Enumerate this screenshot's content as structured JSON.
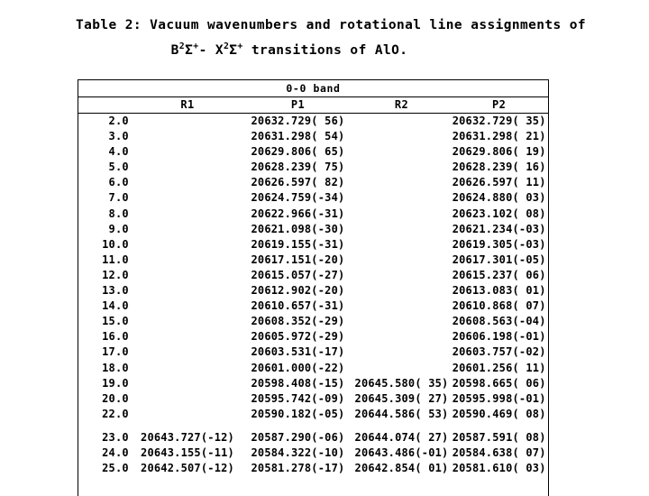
{
  "caption": {
    "line1": "Table 2: Vacuum wavenumbers and rotational line assignments of",
    "line2_pre": "B",
    "line2_sup1": "2",
    "line2_sigma1": "Σ",
    "line2_sup2": "+",
    "line2_dash": "- X",
    "line2_sup3": "2",
    "line2_sigma2": "Σ",
    "line2_sup4": "+",
    "line2_post": " transitions of AlO."
  },
  "table": {
    "band_label": "0-0 band",
    "columns": [
      "",
      "R1",
      "P1",
      "R2",
      "P2"
    ],
    "rows": [
      {
        "j": "2.0",
        "r1": "",
        "p1": "20632.729( 56)",
        "r2": "",
        "p2": "20632.729( 35)"
      },
      {
        "j": "3.0",
        "r1": "",
        "p1": "20631.298( 54)",
        "r2": "",
        "p2": "20631.298( 21)"
      },
      {
        "j": "4.0",
        "r1": "",
        "p1": "20629.806( 65)",
        "r2": "",
        "p2": "20629.806( 19)"
      },
      {
        "j": "5.0",
        "r1": "",
        "p1": "20628.239( 75)",
        "r2": "",
        "p2": "20628.239( 16)"
      },
      {
        "j": "6.0",
        "r1": "",
        "p1": "20626.597( 82)",
        "r2": "",
        "p2": "20626.597( 11)"
      },
      {
        "j": "7.0",
        "r1": "",
        "p1": "20624.759(-34)",
        "r2": "",
        "p2": "20624.880( 03)"
      },
      {
        "j": "8.0",
        "r1": "",
        "p1": "20622.966(-31)",
        "r2": "",
        "p2": "20623.102( 08)"
      },
      {
        "j": "9.0",
        "r1": "",
        "p1": "20621.098(-30)",
        "r2": "",
        "p2": "20621.234(-03)"
      },
      {
        "j": "10.0",
        "r1": "",
        "p1": "20619.155(-31)",
        "r2": "",
        "p2": "20619.305(-03)"
      },
      {
        "j": "11.0",
        "r1": "",
        "p1": "20617.151(-20)",
        "r2": "",
        "p2": "20617.301(-05)"
      },
      {
        "j": "12.0",
        "r1": "",
        "p1": "20615.057(-27)",
        "r2": "",
        "p2": "20615.237( 06)"
      },
      {
        "j": "13.0",
        "r1": "",
        "p1": "20612.902(-20)",
        "r2": "",
        "p2": "20613.083( 01)"
      },
      {
        "j": "14.0",
        "r1": "",
        "p1": "20610.657(-31)",
        "r2": "",
        "p2": "20610.868( 07)"
      },
      {
        "j": "15.0",
        "r1": "",
        "p1": "20608.352(-29)",
        "r2": "",
        "p2": "20608.563(-04)"
      },
      {
        "j": "16.0",
        "r1": "",
        "p1": "20605.972(-29)",
        "r2": "",
        "p2": "20606.198(-01)"
      },
      {
        "j": "17.0",
        "r1": "",
        "p1": "20603.531(-17)",
        "r2": "",
        "p2": "20603.757(-02)"
      },
      {
        "j": "18.0",
        "r1": "",
        "p1": "20601.000(-22)",
        "r2": "",
        "p2": "20601.256( 11)"
      },
      {
        "j": "19.0",
        "r1": "",
        "p1": "20598.408(-15)",
        "r2": "20645.580( 35)",
        "p2": "20598.665( 06)"
      },
      {
        "j": "20.0",
        "r1": "",
        "p1": "20595.742(-09)",
        "r2": "20645.309( 27)",
        "p2": "20595.998(-01)"
      },
      {
        "j": "22.0",
        "r1": "",
        "p1": "20590.182(-05)",
        "r2": "20644.586( 53)",
        "p2": "20590.469( 08)"
      },
      {
        "j": "23.0",
        "r1": "20643.727(-12)",
        "p1": "20587.290(-06)",
        "r2": "20644.074( 27)",
        "p2": "20587.591( 08)"
      },
      {
        "j": "24.0",
        "r1": "20643.155(-11)",
        "p1": "20584.322(-10)",
        "r2": "20643.486(-01)",
        "p2": "20584.638( 07)"
      },
      {
        "j": "25.0",
        "r1": "20642.507(-12)",
        "p1": "20581.278(-17)",
        "r2": "20642.854( 01)",
        "p2": "20581.610( 03)"
      }
    ],
    "gap_before_j": "23.0"
  }
}
